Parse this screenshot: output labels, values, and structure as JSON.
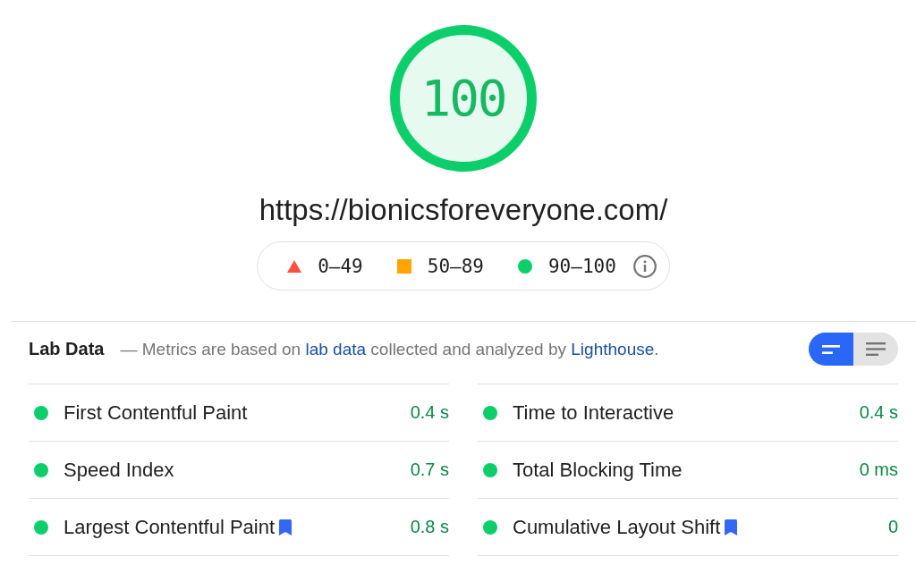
{
  "gauge": {
    "score": "100",
    "level": 1,
    "color": "#0ccf6b"
  },
  "url": "https://bionicsforeveryone.com/",
  "legend": [
    {
      "kind": "fail",
      "label": "0–49"
    },
    {
      "kind": "average",
      "label": "50–89"
    },
    {
      "kind": "pass",
      "label": "90–100"
    }
  ],
  "lab_data": {
    "title": "Lab Data",
    "description": [
      {
        "kind": "text",
        "text": "— Metrics are based on "
      },
      {
        "kind": "link",
        "text": "lab data"
      },
      {
        "kind": "text",
        "text": " collected and analyzed by "
      },
      {
        "kind": "link",
        "text": "Lighthouse"
      },
      {
        "kind": "text",
        "text": "."
      }
    ],
    "view_toggle": [
      {
        "kind": "summary",
        "selected": true
      },
      {
        "kind": "list",
        "selected": false
      }
    ],
    "metrics": [
      {
        "label": "First Contentful Paint",
        "value": "0.4 s",
        "color": "#0ccf6b",
        "core_web_vital": false
      },
      {
        "label": "Time to Interactive",
        "value": "0.4 s",
        "color": "#0ccf6b",
        "core_web_vital": false
      },
      {
        "label": "Speed Index",
        "value": "0.7 s",
        "color": "#0ccf6b",
        "core_web_vital": false
      },
      {
        "label": "Total Blocking Time",
        "value": "0 ms",
        "color": "#0ccf6b",
        "core_web_vital": false
      },
      {
        "label": "Largest Contentful Paint",
        "value": "0.8 s",
        "color": "#0ccf6b",
        "core_web_vital": true
      },
      {
        "label": "Cumulative Layout Shift",
        "value": "0",
        "color": "#0ccf6b",
        "core_web_vital": true
      }
    ]
  }
}
